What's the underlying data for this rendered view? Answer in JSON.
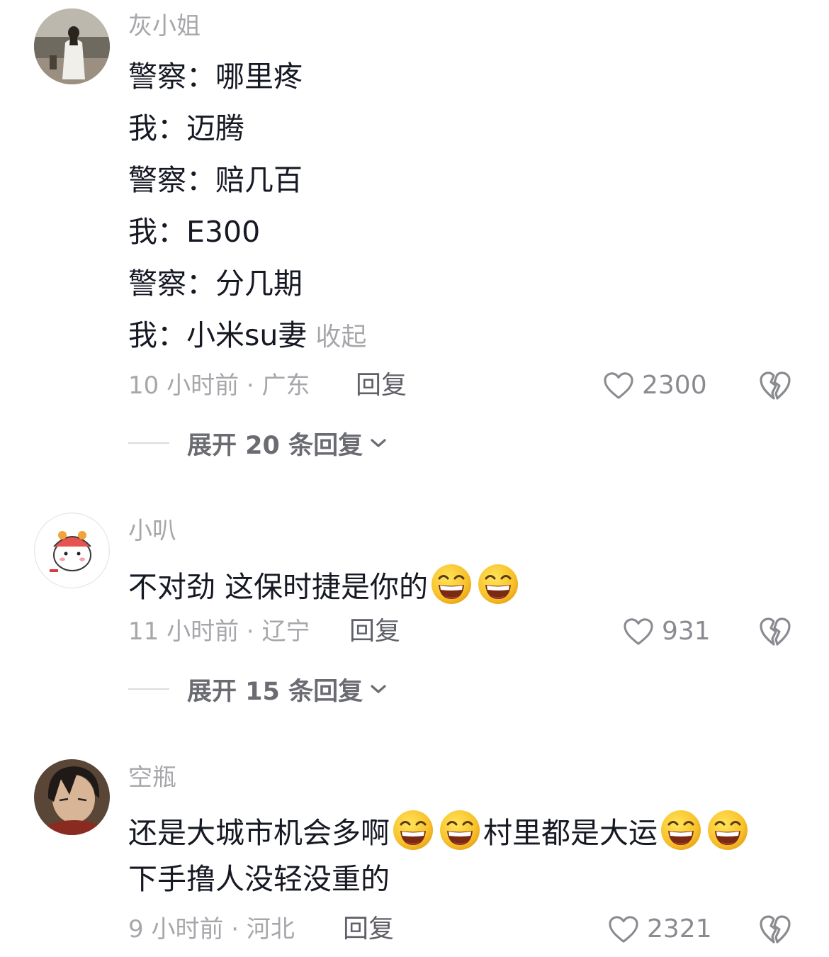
{
  "comments": [
    {
      "username": "灰小姐",
      "lines": [
        "警察：哪里疼",
        "我：迈腾",
        "警察：赔几百",
        "我：E300",
        "警察：分几期",
        "我：小米su妻"
      ],
      "collapse_label": "收起",
      "time_location": "10 小时前 · 广东",
      "reply_label": "回复",
      "likes": "2300",
      "expand_label": "展开 20 条回复"
    },
    {
      "username": "小叭",
      "text": "不对劲 这保时捷是你的",
      "emojis_after": 2,
      "time_location": "11 小时前 · 辽宁",
      "reply_label": "回复",
      "likes": "931",
      "expand_label": "展开 15 条回复"
    },
    {
      "username": "空瓶",
      "line1_part1": "还是大城市机会多啊",
      "line1_part2": "村里都是大运",
      "line2": "下手撸人没轻没重的",
      "time_location": "9 小时前 · 河北",
      "reply_label": "回复",
      "likes": "2321"
    }
  ],
  "icons": {
    "like": "heart-outline-icon",
    "dislike": "broken-heart-icon",
    "expand": "chevron-down-icon",
    "emoji": "grin-emoji"
  },
  "colors": {
    "text": "#161823",
    "secondary": "#a6a7ab",
    "reply": "#5f6068",
    "emoji_face": "#f8c22c"
  }
}
